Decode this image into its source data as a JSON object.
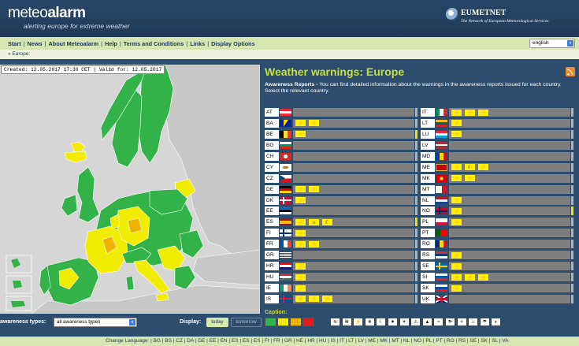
{
  "header": {
    "logo_prefix": "meteo",
    "logo_bold": "alarm",
    "tagline": "alerting europe for extreme weather",
    "partner_name": "EUMETNET",
    "partner_tagline": "The Network of European Meteorological Services"
  },
  "nav": {
    "items": [
      "Start",
      "News",
      "About Meteoalarm",
      "Help",
      "Terms and Conditions",
      "Links",
      "Display Options"
    ],
    "language_selected": "english"
  },
  "breadcrumb": "» Europe:",
  "map": {
    "info_text": "Created: 12.05.2017 17:30 CET | Valid for: 12.05.2017"
  },
  "panel": {
    "title": "Weather warnings: Europe",
    "desc_bold": "Awareness Reports -",
    "desc_text": " You can find detailed information about the warnings in the awareness reports issued for each country. Select the relevant country."
  },
  "colors": {
    "green": "#33b24a",
    "yellow": "#f2ec00",
    "orange": "#f0b400",
    "red": "#e11b22",
    "no_data": "#c8c8c8",
    "accent_green": "#c6df3a"
  },
  "countries_left": [
    {
      "code": "AT",
      "flag": "AT",
      "warnings": [],
      "edge": "gray"
    },
    {
      "code": "BA",
      "flag": "BA",
      "warnings": [
        "⚡",
        "⚡"
      ],
      "edge": "gray"
    },
    {
      "code": "BE",
      "flag": "BE",
      "warnings": [
        "⚡"
      ],
      "edge": "y"
    },
    {
      "code": "BG",
      "flag": "BG",
      "warnings": [],
      "edge": "gray"
    },
    {
      "code": "CH",
      "flag": "CH",
      "warnings": [],
      "edge": "gray"
    },
    {
      "code": "CY",
      "flag": "CY",
      "warnings": [],
      "edge": "gray"
    },
    {
      "code": "CZ",
      "flag": "CZ",
      "warnings": [],
      "edge": "gray"
    },
    {
      "code": "DE",
      "flag": "DE",
      "warnings": [
        "⚡",
        "⚡"
      ],
      "edge": "gray"
    },
    {
      "code": "DK",
      "flag": "DK",
      "warnings": [
        "⚡"
      ],
      "edge": "gray"
    },
    {
      "code": "EE",
      "flag": "EE",
      "warnings": [],
      "edge": "gray"
    },
    {
      "code": "ES",
      "flag": "ES",
      "warnings": [
        "⚡",
        "☼",
        "☾"
      ],
      "edge": "y"
    },
    {
      "code": "FI",
      "flag": "FI",
      "warnings": [
        "⚡"
      ],
      "edge": "gray"
    },
    {
      "code": "FR",
      "flag": "FR",
      "warnings": [
        "⚡",
        "⚡"
      ],
      "edge": "gray"
    },
    {
      "code": "GR",
      "flag": "GR",
      "warnings": [],
      "edge": "gray"
    },
    {
      "code": "HR",
      "flag": "HR",
      "warnings": [
        "⚡"
      ],
      "edge": "gray"
    },
    {
      "code": "HU",
      "flag": "HU",
      "warnings": [
        "⚡"
      ],
      "edge": "gray"
    },
    {
      "code": "IE",
      "flag": "IE",
      "warnings": [
        "⚡"
      ],
      "edge": "gray"
    },
    {
      "code": "IS",
      "flag": "IS",
      "warnings": [
        "⚡",
        "⚡",
        "⚡"
      ],
      "edge": "gray"
    }
  ],
  "countries_right": [
    {
      "code": "IT",
      "flag": "IT",
      "warnings": [
        "⚡",
        "⚡",
        "⚡"
      ],
      "edge": "gray"
    },
    {
      "code": "LT",
      "flag": "LT",
      "warnings": [
        "⚡"
      ],
      "edge": "gray"
    },
    {
      "code": "LU",
      "flag": "LU",
      "warnings": [
        "⚡"
      ],
      "edge": "gray"
    },
    {
      "code": "LV",
      "flag": "LV",
      "warnings": [],
      "edge": "gray"
    },
    {
      "code": "MD",
      "flag": "MD",
      "warnings": [],
      "edge": "gray"
    },
    {
      "code": "ME",
      "flag": "ME",
      "warnings": [
        "⚡",
        "☾",
        "⚡"
      ],
      "edge": "gray"
    },
    {
      "code": "MK",
      "flag": "MK",
      "warnings": [
        "⚡",
        "⚡"
      ],
      "edge": "gray"
    },
    {
      "code": "MT",
      "flag": "MT",
      "warnings": [],
      "edge": "gray"
    },
    {
      "code": "NL",
      "flag": "NL",
      "warnings": [
        "⚡"
      ],
      "edge": "gray"
    },
    {
      "code": "NO",
      "flag": "NO",
      "warnings": [
        "⚡"
      ],
      "edge": "y"
    },
    {
      "code": "PL",
      "flag": "PL",
      "warnings": [
        "⚡"
      ],
      "edge": "gray"
    },
    {
      "code": "PT",
      "flag": "PT",
      "warnings": [],
      "edge": "gray"
    },
    {
      "code": "RO",
      "flag": "RO",
      "warnings": [],
      "edge": "gray"
    },
    {
      "code": "RS",
      "flag": "RS",
      "warnings": [
        "⚡"
      ],
      "edge": "gray"
    },
    {
      "code": "SE",
      "flag": "SE",
      "warnings": [
        "⚡"
      ],
      "edge": "gray"
    },
    {
      "code": "SI",
      "flag": "SI",
      "warnings": [
        "⚡",
        "⚡",
        "⚡"
      ],
      "edge": "gray"
    },
    {
      "code": "SK",
      "flag": "SK",
      "warnings": [
        "⚡"
      ],
      "edge": "gray"
    },
    {
      "code": "UK",
      "flag": "UK",
      "warnings": [],
      "edge": "gray"
    }
  ],
  "caption": {
    "label": "Caption:",
    "type_icons": [
      "≋",
      "✻",
      "⚡",
      "❄",
      "☾",
      "✷",
      "☀",
      "⚠",
      "▲",
      "≈",
      "⛈",
      "✧",
      "♨",
      "☂",
      "◐"
    ]
  },
  "filters": {
    "awareness_label": "awareness types:",
    "awareness_value": "all awareness types",
    "display_label": "Display:",
    "today_label": "today",
    "tomorrow_label": "tomorrow"
  },
  "footer": {
    "label": "Change Language:",
    "languages": [
      "BG",
      "BS",
      "CZ",
      "DA",
      "DE",
      "EE",
      "EN",
      "ES",
      "ES",
      "ES",
      "FI",
      "FR",
      "GR",
      "HE",
      "HR",
      "HU",
      "IS",
      "IT",
      "LT",
      "LV",
      "ME",
      "MK",
      "MT",
      "NL",
      "NO",
      "PL",
      "PT",
      "RO",
      "RS",
      "SE",
      "SK",
      "SL",
      "VA"
    ]
  }
}
